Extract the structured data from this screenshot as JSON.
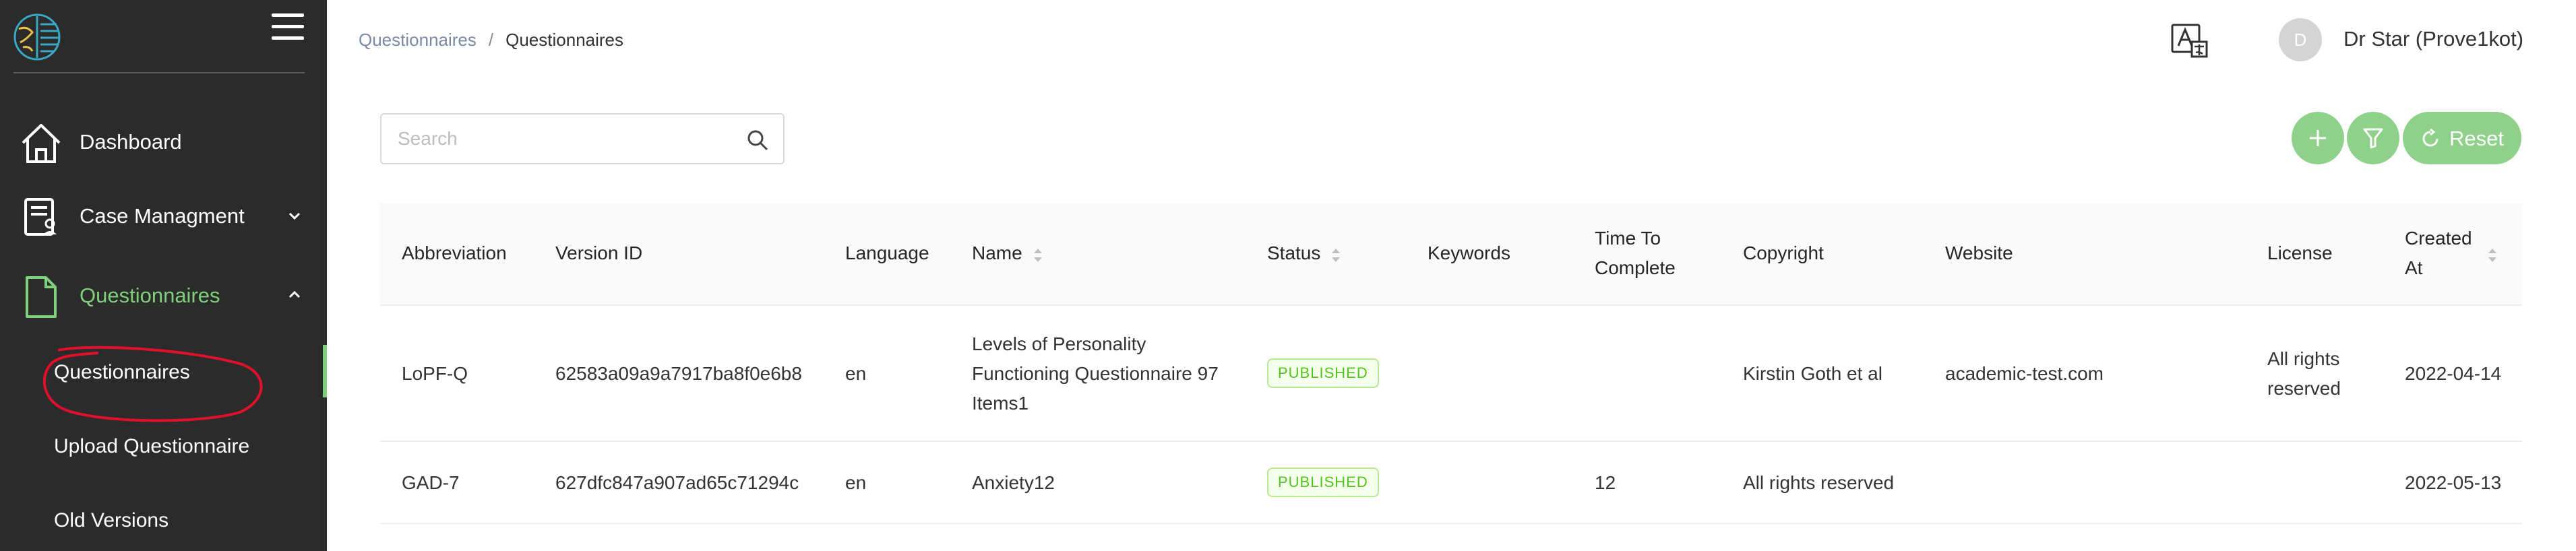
{
  "sidebar": {
    "logo_icon": "brain-logo-icon",
    "menu_icon": "hamburger-icon",
    "items": [
      {
        "label": "Dashboard",
        "icon": "home-icon"
      },
      {
        "label": "Case Managment",
        "icon": "case-icon",
        "chevron": "chevron-down-icon"
      },
      {
        "label": "Questionnaires",
        "icon": "document-icon",
        "chevron": "chevron-up-icon",
        "active": true
      }
    ],
    "sub_items": [
      {
        "label": "Questionnaires",
        "active": true
      },
      {
        "label": "Upload Questionnaire"
      },
      {
        "label": "Old Versions"
      }
    ],
    "accent_color": "#7ed07a"
  },
  "header": {
    "breadcrumb": [
      "Questionnaires",
      "/",
      "Questionnaires"
    ],
    "translate_icon": "translate-icon",
    "avatar_initial": "D",
    "user_name": "Dr Star (Prove1kot)"
  },
  "search": {
    "placeholder": "Search",
    "value": "",
    "icon": "search-icon"
  },
  "actions": {
    "add_icon": "plus-icon",
    "filter_icon": "filter-icon",
    "reset_label": "Reset",
    "reset_icon": "refresh-icon",
    "color": "#8fd18a"
  },
  "table": {
    "columns": [
      {
        "label": "Abbreviation"
      },
      {
        "label": "Version ID"
      },
      {
        "label": "Language"
      },
      {
        "label": "Name",
        "sortable": true
      },
      {
        "label": "Status",
        "sortable": true
      },
      {
        "label": "Keywords"
      },
      {
        "label": "Time To Complete"
      },
      {
        "label": "Copyright"
      },
      {
        "label": "Website"
      },
      {
        "label": "License"
      },
      {
        "label": "Created At",
        "sortable": true
      }
    ],
    "rows": [
      {
        "abbreviation": "LoPF-Q",
        "version_id": "62583a09a9a7917ba8f0e6b8",
        "language": "en",
        "name": "Levels of Personality Functioning Questionnaire 97 Items1",
        "status": "PUBLISHED",
        "keywords": "",
        "time_to_complete": "",
        "copyright": "Kirstin Goth et al",
        "website": "academic-test.com",
        "license": "All rights reserved",
        "created_at": "2022-04-14"
      },
      {
        "abbreviation": "GAD-7",
        "version_id": "627dfc847a907ad65c71294c",
        "language": "en",
        "name": "Anxiety12",
        "status": "PUBLISHED",
        "keywords": "",
        "time_to_complete": "12",
        "copyright": "All rights reserved",
        "website": "",
        "license": "",
        "created_at": "2022-05-13"
      }
    ]
  }
}
